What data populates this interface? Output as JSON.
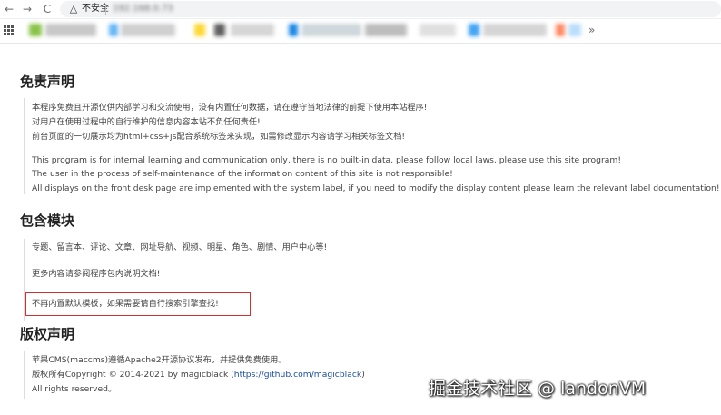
{
  "browser": {
    "back_label": "←",
    "forward_label": "→",
    "reload_label": "C",
    "warning_icon": "△",
    "security_label": "不安全",
    "url": "192.168.0.73",
    "bookmarks_more": "»"
  },
  "sections": {
    "disclaimer": {
      "title": "免责声明",
      "lines": [
        "本程序免费且开源仅供内部学习和交流使用，没有内置任何数据，请在遵守当地法律的前提下使用本站程序!",
        "对用户在使用过程中的自行维护的信息内容本站不负任何责任!",
        "前台页面的一切展示均为html+css+js配合系统标签来实现，如需修改显示内容请学习相关标签文档!",
        "This program is for internal learning and communication only, there is no built-in data, please follow local laws, please use this site program!",
        "The user in the process of self-maintenance of the information content of this site is not responsible!",
        "All displays on the front desk page are implemented with the system label, if you need to modify the display content please learn the relevant label documentation!"
      ]
    },
    "modules": {
      "title": "包含模块",
      "lines": [
        "专题、留言本、评论、文章、网址导航、视频、明星、角色、剧情、用户中心等!",
        "更多内容请参阅程序包内说明文档!",
        "不再内置默认模板，如果需要请自行搜索引擎查找!"
      ]
    },
    "copyright": {
      "title": "版权声明",
      "line1": "苹果CMS(maccms)遵循Apache2开源协议发布，并提供免费使用。",
      "line2_prefix": "版权所有Copyright © 2014-2021 by magicblack (",
      "line2_link": "https://github.com/magicblack",
      "line2_suffix": ")",
      "line3": "All rights reserved。"
    }
  },
  "watermark": "掘金技术社区 @ landonVM"
}
